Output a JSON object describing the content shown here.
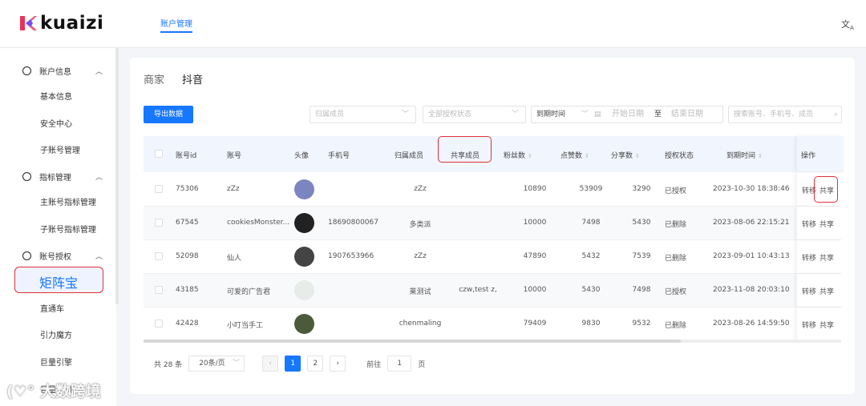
{
  "header": {
    "logo": "kuaizi",
    "nav": "账户管理",
    "lang_icon": "translate-icon"
  },
  "sidebar": {
    "groups": [
      {
        "label": "账户信息",
        "items": [
          "基本信息",
          "安全中心",
          "子账号管理"
        ]
      },
      {
        "label": "指标管理",
        "items": [
          "主账号指标管理",
          "子账号指标管理"
        ]
      },
      {
        "label": "账号授权",
        "items": [
          "矩阵宝",
          "直通车",
          "引力魔方",
          "巨量引擎",
          "巨量千川"
        ]
      }
    ]
  },
  "tabs": [
    "商家",
    "抖音"
  ],
  "toolbar": {
    "export": "导出数据",
    "member_ph": "归属成员",
    "auth_ph": "全部授权状态",
    "date_type": "到期时间",
    "start_ph": "开始日期",
    "to": "至",
    "end_ph": "结束日期",
    "search_ph": "搜索账号、手机号、成员"
  },
  "columns": [
    "账号id",
    "账号",
    "头像",
    "手机号",
    "归属成员",
    "共享成员",
    "粉丝数",
    "点赞数",
    "分享数",
    "授权状态",
    "到期时间",
    "操作"
  ],
  "rows": [
    {
      "id": "75306",
      "account": "zZz",
      "phone": "",
      "owner": "zZz",
      "shared": "",
      "fans": "10890",
      "likes": "53909",
      "shares": "3290",
      "status": "已授权",
      "expire": "2023-10-30 18:38:46",
      "avatar": "#7b86c0"
    },
    {
      "id": "67545",
      "account": "cookiesMonster...",
      "phone": "18690800067",
      "owner": "多类派",
      "shared": "",
      "fans": "10000",
      "likes": "7498",
      "shares": "5430",
      "status": "已删除",
      "expire": "2023-08-06 22:15:21",
      "avatar": "#222"
    },
    {
      "id": "52098",
      "account": "仙人",
      "phone": "1907653966",
      "owner": "zZz",
      "shared": "",
      "fans": "47890",
      "likes": "5432",
      "shares": "7539",
      "status": "已删除",
      "expire": "2023-09-01 10:43:13",
      "avatar": "#444"
    },
    {
      "id": "43185",
      "account": "可爱的广告君",
      "phone": "",
      "owner": "莱测试",
      "shared": "czw,test z,",
      "fans": "10000",
      "likes": "5430",
      "shares": "7498",
      "status": "已授权",
      "expire": "2023-11-08 20:03:10",
      "avatar": "#e8ece8"
    },
    {
      "id": "42428",
      "account": "小叮当手工",
      "phone": "",
      "owner": "chenmaling",
      "shared": "",
      "fans": "79409",
      "likes": "9830",
      "shares": "9532",
      "status": "已删除",
      "expire": "2023-08-26 14:59:50",
      "avatar": "#4a5a3a"
    }
  ],
  "actions": {
    "transfer": "转移",
    "share": "共享"
  },
  "pagination": {
    "total": "共 28 条",
    "size": "20条/页",
    "pages": [
      "1",
      "2"
    ],
    "goto": "前往",
    "goto_value": "1",
    "page_unit": "页"
  },
  "watermark": "大数跨境"
}
